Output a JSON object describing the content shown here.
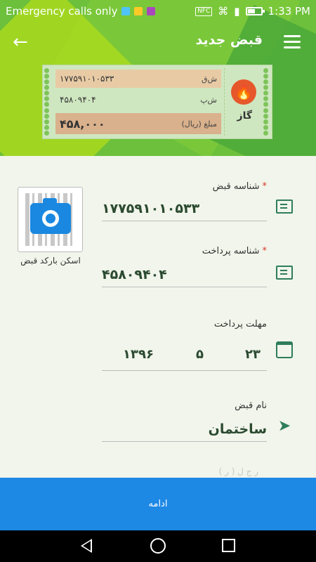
{
  "status_bar": {
    "carrier_text": "Emergency calls only",
    "nfc_label": "NFC",
    "time": "1:33 PM",
    "battery_level": 0.5
  },
  "header": {
    "title": "قبض جدید"
  },
  "bill_card": {
    "type_label": "گاز",
    "row1_label": "ش‌ق",
    "row1_value": "۱۷۷۵۹۱۰۱۰۵۳۳",
    "row2_label": "ش‌پ",
    "row2_value": "۴۵۸۰۹۴۰۴",
    "row3_label": "مبلغ (ریال)",
    "row3_value": "۴۵۸,۰۰۰"
  },
  "form": {
    "bill_id_label": "شناسه قبض",
    "bill_id_value": "۱۷۷۵۹۱۰۱۰۵۳۳",
    "payment_id_label": "شناسه پرداخت",
    "payment_id_value": "۴۵۸۰۹۴۰۴",
    "deadline_label": "مهلت پرداخت",
    "deadline_day": "۲۳",
    "deadline_month": "۵",
    "deadline_year": "۱۳۹۶",
    "bill_name_label": "نام قبض",
    "bill_name_value": "ساختمان",
    "required_mark": "*",
    "faded_text": "ر  ج   ل   ( ر  )"
  },
  "scanner": {
    "label": "اسکن بارکد قبض"
  },
  "continue_button": {
    "label": "ادامه"
  },
  "colors": {
    "header_green": "#6cc03b",
    "accent_blue": "#1e88e5",
    "icon_green": "#2e7d5b",
    "gas_orange": "#e6582b"
  }
}
